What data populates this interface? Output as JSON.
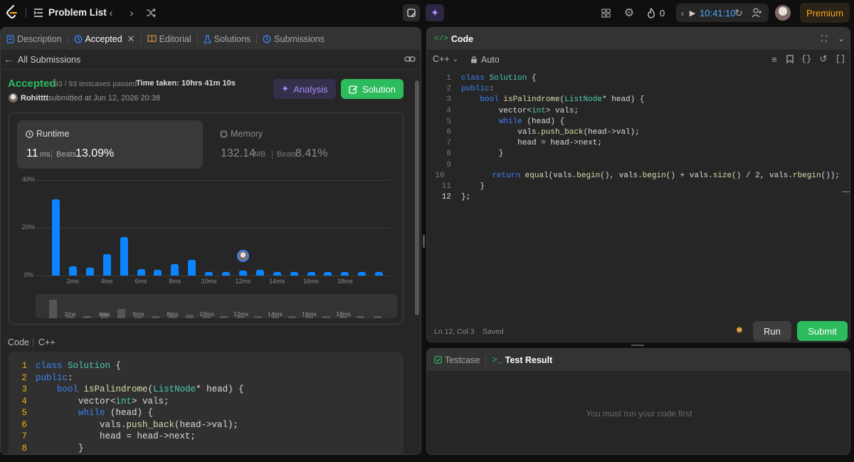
{
  "topbar": {
    "title": "Problem List",
    "streak": "0",
    "timer": "10:41:10",
    "premium": "Premium"
  },
  "left": {
    "tabs": [
      "Description",
      "Accepted",
      "Editorial",
      "Solutions",
      "Submissions"
    ],
    "back_label": "All Submissions",
    "status": "Accepted",
    "testcases": "93 / 93 testcases passed",
    "time_taken": "Time taken: 10hrs 41m 10s",
    "user": "Rohitttt",
    "submitted": "submitted at Jun 12, 2026 20:38",
    "analysis_label": "Analysis",
    "solution_label": "Solution",
    "runtime": {
      "label": "Runtime",
      "value": "11",
      "unit": "ms",
      "beats_label": "Beats",
      "beats": "13.09%"
    },
    "memory": {
      "label": "Memory",
      "value": "132.14",
      "unit": "MB",
      "beats_label": "Beats",
      "beats": "8.41%"
    },
    "code_label": "Code",
    "code_lang": "C++"
  },
  "chart_data": {
    "type": "bar",
    "y_ticks": [
      "40%",
      "20%",
      "0%"
    ],
    "x_ticks": [
      "2ms",
      "4ms",
      "6ms",
      "8ms",
      "10ms",
      "12ms",
      "14ms",
      "16ms",
      "18ms"
    ],
    "ylim": [
      0,
      40
    ],
    "values": [
      32,
      4,
      3.3,
      9,
      16,
      2.8,
      2.5,
      4.7,
      6.7,
      1.4,
      1.4,
      2.2,
      2.4,
      1.4,
      1.4,
      1.4,
      1.4,
      1.4,
      1.4,
      1.4
    ],
    "mini_x_ticks": [
      "2ms",
      "4ms",
      "6ms",
      "8ms",
      "10ms",
      "12ms",
      "14ms",
      "16ms",
      "18ms"
    ]
  },
  "right": {
    "code_title": "Code",
    "lang": "C++",
    "mode": "Auto",
    "status_pos": "Ln 12, Col 3",
    "status_saved": "Saved",
    "run": "Run",
    "submit": "Submit",
    "testcase_tab": "Testcase",
    "result_tab": "Test Result",
    "empty_msg": "You must run your code first"
  },
  "code_lines": [
    "class Solution {",
    "public:",
    "    bool isPalindrome(ListNode* head) {",
    "        vector<int> vals;",
    "        while (head) {",
    "            vals.push_back(head->val);",
    "            head = head->next;",
    "        }",
    "",
    "        return equal(vals.begin(), vals.begin() + vals.size() / 2, vals.rbegin());",
    "    }",
    "};"
  ]
}
